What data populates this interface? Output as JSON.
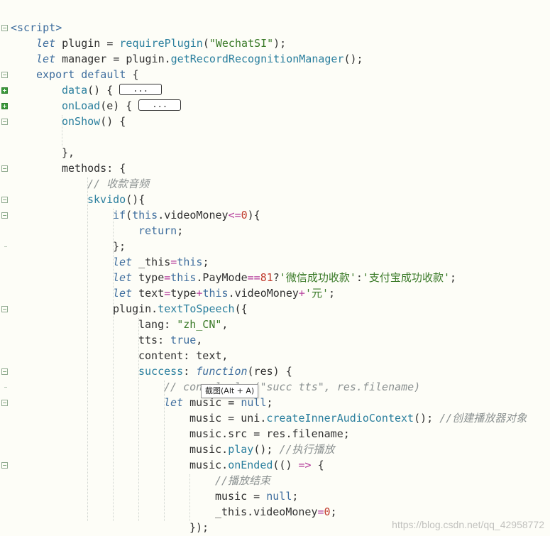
{
  "editor": {
    "lines": [
      {
        "tokens": [
          [
            "tag",
            "<script>"
          ]
        ]
      },
      {
        "tokens": [
          [
            "kwi",
            "let"
          ],
          [
            "prop",
            " plugin = "
          ],
          [
            "fn",
            "requirePlugin"
          ],
          [
            "prop",
            "("
          ],
          [
            "str",
            "\"WechatSI\""
          ],
          [
            "prop",
            ");"
          ]
        ]
      },
      {
        "tokens": [
          [
            "kwi",
            "let"
          ],
          [
            "prop",
            " manager = plugin."
          ],
          [
            "fn",
            "getRecordRecognitionManager"
          ],
          [
            "prop",
            "();"
          ]
        ]
      },
      {
        "tokens": [
          [
            "kw",
            "export default"
          ],
          [
            "prop",
            " {"
          ]
        ]
      },
      {
        "tokens": [
          [
            "fn",
            "data"
          ],
          [
            "prop",
            "() { "
          ]
        ],
        "collapsed": "..."
      },
      {
        "tokens": [
          [
            "fn",
            "onLoad"
          ],
          [
            "prop",
            "(e) { "
          ]
        ],
        "collapsed": "..."
      },
      {
        "tokens": [
          [
            "fn",
            "onShow"
          ],
          [
            "prop",
            "() {"
          ]
        ]
      },
      {
        "tokens": []
      },
      {
        "tokens": [
          [
            "prop",
            "},"
          ]
        ]
      },
      {
        "tokens": [
          [
            "prop",
            "methods: {"
          ]
        ]
      },
      {
        "tokens": [
          [
            "cmt",
            "// 收款音频"
          ]
        ]
      },
      {
        "tokens": [
          [
            "fn",
            "skvido"
          ],
          [
            "prop",
            "(){"
          ]
        ]
      },
      {
        "tokens": [
          [
            "kw",
            "if"
          ],
          [
            "prop",
            "("
          ],
          [
            "kw",
            "this"
          ],
          [
            "prop",
            ".videoMoney"
          ],
          [
            "op",
            "<="
          ],
          [
            "num",
            "0"
          ],
          [
            "prop",
            "){"
          ]
        ]
      },
      {
        "tokens": [
          [
            "kw",
            "return"
          ],
          [
            "prop",
            ";"
          ]
        ]
      },
      {
        "tokens": [
          [
            "prop",
            "};"
          ]
        ]
      },
      {
        "tokens": [
          [
            "kwi",
            "let"
          ],
          [
            "prop",
            " _this"
          ],
          [
            "op",
            "="
          ],
          [
            "kw",
            "this"
          ],
          [
            "prop",
            ";"
          ]
        ]
      },
      {
        "tokens": [
          [
            "kwi",
            "let"
          ],
          [
            "prop",
            " type"
          ],
          [
            "op",
            "="
          ],
          [
            "kw",
            "this"
          ],
          [
            "prop",
            ".PayMode"
          ],
          [
            "op",
            "=="
          ],
          [
            "num",
            "81"
          ],
          [
            "prop",
            "?"
          ],
          [
            "str",
            "'微信成功收款'"
          ],
          [
            "prop",
            ":"
          ],
          [
            "str",
            "'支付宝成功收款'"
          ],
          [
            "prop",
            ";"
          ]
        ]
      },
      {
        "tokens": [
          [
            "kwi",
            "let"
          ],
          [
            "prop",
            " text"
          ],
          [
            "op",
            "="
          ],
          [
            "prop",
            "type"
          ],
          [
            "op",
            "+"
          ],
          [
            "kw",
            "this"
          ],
          [
            "prop",
            ".videoMoney"
          ],
          [
            "op",
            "+"
          ],
          [
            "str",
            "'元'"
          ],
          [
            "prop",
            ";"
          ]
        ]
      },
      {
        "tokens": [
          [
            "prop",
            "plugin."
          ],
          [
            "fn",
            "textToSpeech"
          ],
          [
            "prop",
            "({"
          ]
        ]
      },
      {
        "tokens": [
          [
            "prop",
            "lang: "
          ],
          [
            "str",
            "\"zh_CN\""
          ],
          [
            "prop",
            ","
          ]
        ]
      },
      {
        "tokens": [
          [
            "prop",
            "tts: "
          ],
          [
            "kw",
            "true"
          ],
          [
            "prop",
            ","
          ]
        ]
      },
      {
        "tokens": [
          [
            "prop",
            "content: text,"
          ]
        ]
      },
      {
        "tokens": [
          [
            "fn",
            "success"
          ],
          [
            "prop",
            ": "
          ],
          [
            "kwi",
            "function"
          ],
          [
            "prop",
            "(res) {"
          ]
        ]
      },
      {
        "tokens": [
          [
            "cmt",
            "// console.log(\"succ tts\", res.filename)"
          ]
        ]
      },
      {
        "tokens": [
          [
            "kwi",
            "let"
          ],
          [
            "prop",
            " music = "
          ],
          [
            "kw",
            "null"
          ],
          [
            "prop",
            ";"
          ]
        ]
      },
      {
        "tokens": [
          [
            "prop",
            "music = uni."
          ],
          [
            "fn",
            "createInnerAudioContext"
          ],
          [
            "prop",
            "(); "
          ],
          [
            "cmt",
            "//创建播放器对象"
          ]
        ]
      },
      {
        "tokens": [
          [
            "prop",
            "music.src = res.filename;"
          ]
        ]
      },
      {
        "tokens": [
          [
            "prop",
            "music."
          ],
          [
            "fn",
            "play"
          ],
          [
            "prop",
            "(); "
          ],
          [
            "cmt",
            "//执行播放"
          ]
        ]
      },
      {
        "tokens": [
          [
            "prop",
            "music."
          ],
          [
            "fn",
            "onEnded"
          ],
          [
            "prop",
            "(() "
          ],
          [
            "op",
            "=>"
          ],
          [
            "prop",
            " {"
          ]
        ]
      },
      {
        "tokens": [
          [
            "cmt",
            "//播放结束"
          ]
        ]
      },
      {
        "tokens": [
          [
            "prop",
            "music = "
          ],
          [
            "kw",
            "null"
          ],
          [
            "prop",
            ";"
          ]
        ]
      },
      {
        "tokens": [
          [
            "prop",
            "_this.videoMoney"
          ],
          [
            "op",
            "="
          ],
          [
            "num",
            "0"
          ],
          [
            "prop",
            ";"
          ]
        ]
      },
      {
        "tokens": [
          [
            "prop",
            "});"
          ]
        ]
      }
    ]
  },
  "tooltip": {
    "label": "截图(Alt + A)"
  },
  "watermark": {
    "text": "https://blog.csdn.net/qq_42958772"
  }
}
